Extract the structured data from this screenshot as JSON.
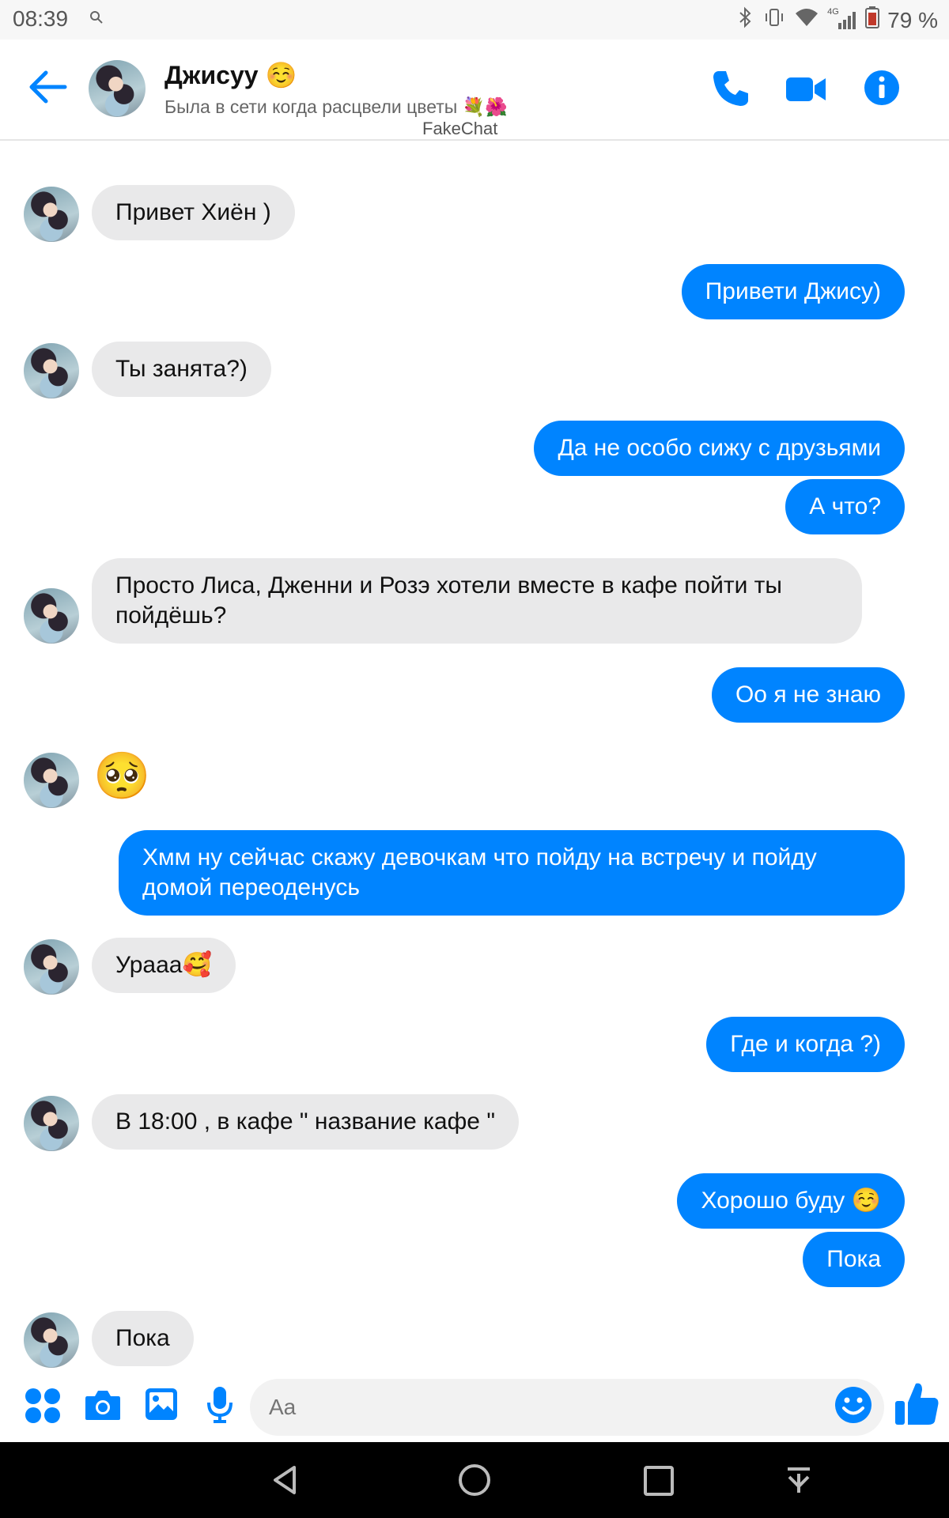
{
  "status_bar": {
    "time": "08:39",
    "battery": "79 %",
    "network": "4G"
  },
  "header": {
    "contact_name": "Джисуу ☺️",
    "status": "Была в сети когда расцвели цветы 💐🌺",
    "watermark": "FakeChat",
    "icons": [
      "back-arrow-icon",
      "phone-icon",
      "video-camera-icon",
      "info-icon"
    ]
  },
  "messages": [
    {
      "from": "them",
      "text": "Привет Хиён )"
    },
    {
      "from": "me",
      "text": "Привети Джису)"
    },
    {
      "from": "them",
      "text": "Ты занята?)"
    },
    {
      "from": "me",
      "text": "Да не особо сижу с друзьями"
    },
    {
      "from": "me",
      "text": "А что?"
    },
    {
      "from": "them",
      "text": "Просто Лиса, Дженни и Розэ хотели вместе в кафе пойти ты пойдёшь?"
    },
    {
      "from": "me",
      "text": "Оо я не знаю"
    },
    {
      "from": "them",
      "text": "🥺"
    },
    {
      "from": "me",
      "text": "Хмм ну сейчас скажу девочкам что пойду на встречу и пойду домой переоденусь"
    },
    {
      "from": "them",
      "text": "Урааа🥰"
    },
    {
      "from": "me",
      "text": "Где и когда ?)"
    },
    {
      "from": "them",
      "text": "В 18:00 , в кафе \" название кафе \""
    },
    {
      "from": "me",
      "text": "Хорошо буду ☺️"
    },
    {
      "from": "me",
      "text": "Пока"
    },
    {
      "from": "them",
      "text": "Пока"
    }
  ],
  "composer": {
    "placeholder": "Aa",
    "icons": [
      "apps-icon",
      "camera-icon",
      "image-icon",
      "microphone-icon",
      "emoji-icon",
      "thumbs-up-icon"
    ]
  },
  "nav_bar": {
    "icons": [
      "back-triangle-icon",
      "home-circle-icon",
      "recents-square-icon",
      "notifications-pull-icon"
    ]
  },
  "colors": {
    "accent": "#0084ff",
    "incoming_bubble": "#e9e9ea",
    "nav_bar": "#000000"
  }
}
